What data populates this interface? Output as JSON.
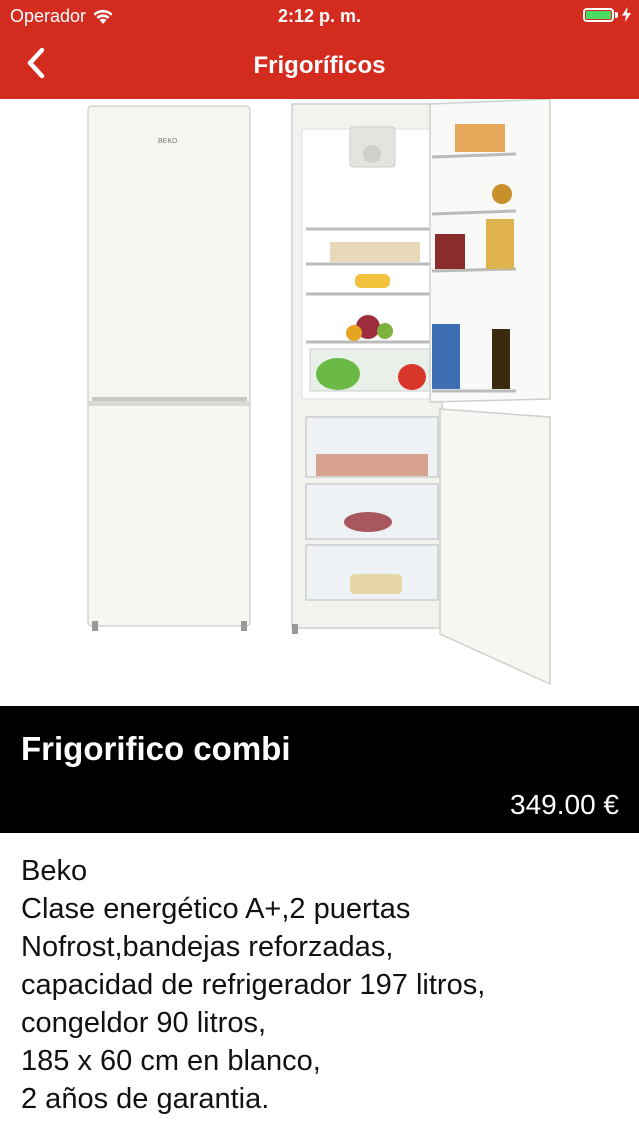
{
  "status_bar": {
    "carrier": "Operador",
    "time": "2:12 p. m.",
    "battery_color": "#4cd964"
  },
  "nav": {
    "title": "Frigoríficos",
    "back_icon": "chevron-left-icon",
    "background_color": "#d42b1f"
  },
  "product": {
    "image": "fridge-product-photo",
    "title": "Frigorifico combi",
    "price": "349.00 €",
    "description_lines": [
      "Beko",
      "Clase energético A+,2 puertas",
      "Nofrost,bandejas reforzadas,",
      "capacidad de refrigerador 197 litros,",
      "congeldor 90 litros,",
      "185 x 60 cm en blanco,",
      "2 años de garantia."
    ]
  }
}
